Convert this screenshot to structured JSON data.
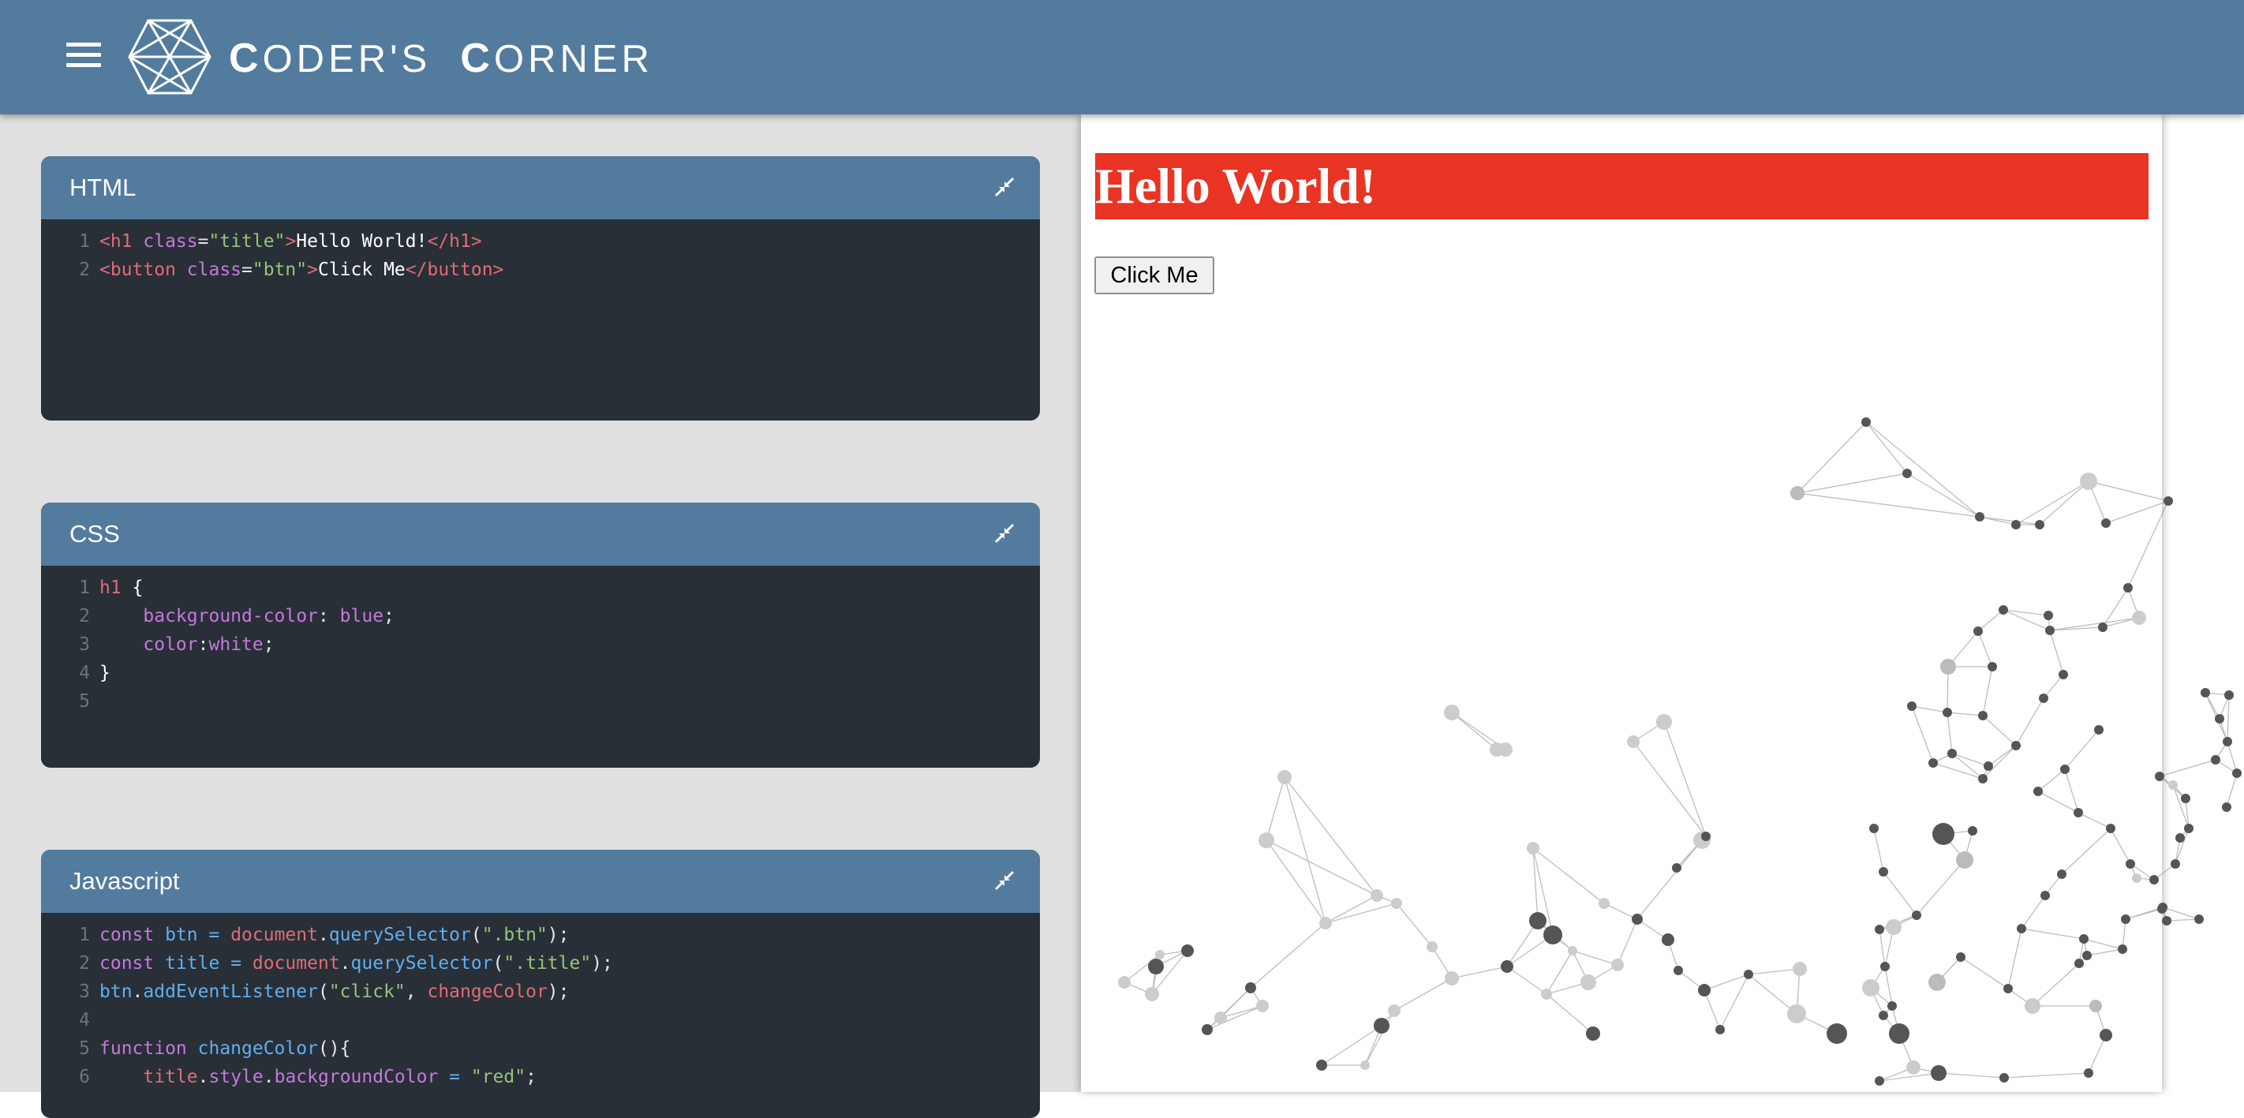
{
  "header": {
    "brand_first_1": "C",
    "brand_rest_1": "ODER'S",
    "brand_first_2": "C",
    "brand_rest_2": "ORNER"
  },
  "panels": {
    "html": {
      "title": "HTML"
    },
    "css": {
      "title": "CSS"
    },
    "js": {
      "title": "Javascript"
    }
  },
  "html_code": [
    {
      "n": "1",
      "tag_open": "<h1 ",
      "attr": "class",
      "eq": "=",
      "str": "\"title\"",
      "close": ">",
      "text": "Hello World!",
      "end": "</h1>"
    },
    {
      "n": "2",
      "tag_open": "<button ",
      "attr": "class",
      "eq": "=",
      "str": "\"btn\"",
      "close": ">",
      "text": "Click Me",
      "end": "</button>"
    }
  ],
  "css_code": [
    {
      "n": "1",
      "sel": "h1",
      "rest": " {"
    },
    {
      "n": "2",
      "indent": "    ",
      "prop": "background-color",
      "sep": ": ",
      "val": "blue",
      "end": ";"
    },
    {
      "n": "3",
      "indent": "    ",
      "prop": "color",
      "sep": ":",
      "val": "white",
      "end": ";"
    },
    {
      "n": "4",
      "sel": "",
      "rest": "}"
    },
    {
      "n": "5",
      "sel": "",
      "rest": ""
    }
  ],
  "js_code": [
    {
      "n": "1",
      "kw": "const ",
      "var": "btn",
      "op": " = ",
      "obj": "document",
      "dot": ".",
      "fn": "querySelector",
      "p1": "(",
      "str": "\".btn\"",
      "p2": ");"
    },
    {
      "n": "2",
      "kw": "const ",
      "var": "title",
      "op": " = ",
      "obj": "document",
      "dot": ".",
      "fn": "querySelector",
      "p1": "(",
      "str": "\".title\"",
      "p2": ");"
    },
    {
      "n": "3",
      "var": "btn",
      "dot": ".",
      "fn": "addEventListener",
      "p1": "(",
      "str": "\"click\"",
      "comma": ", ",
      "obj": "changeColor",
      "p2": ");"
    },
    {
      "n": "4"
    },
    {
      "n": "5",
      "kw": "function ",
      "fn": "changeColor",
      "p2": "(){"
    },
    {
      "n": "6",
      "indent": "    ",
      "var": "title",
      "dot": ".",
      "prop": "style",
      "dot2": ".",
      "prop2": "backgroundColor",
      "op": " = ",
      "str": "\"red\"",
      "p2": ";"
    }
  ],
  "preview": {
    "heading": "Hello World!",
    "button": "Click Me",
    "heading_bg": "#e93323"
  },
  "colors": {
    "header_bg": "#527b9e",
    "editor_bg": "#282f37",
    "page_bg": "#e0e0e0"
  },
  "icons": {
    "menu": "hamburger-icon",
    "logo": "hexagon-logo",
    "collapse": "collapse-arrows-icon"
  }
}
